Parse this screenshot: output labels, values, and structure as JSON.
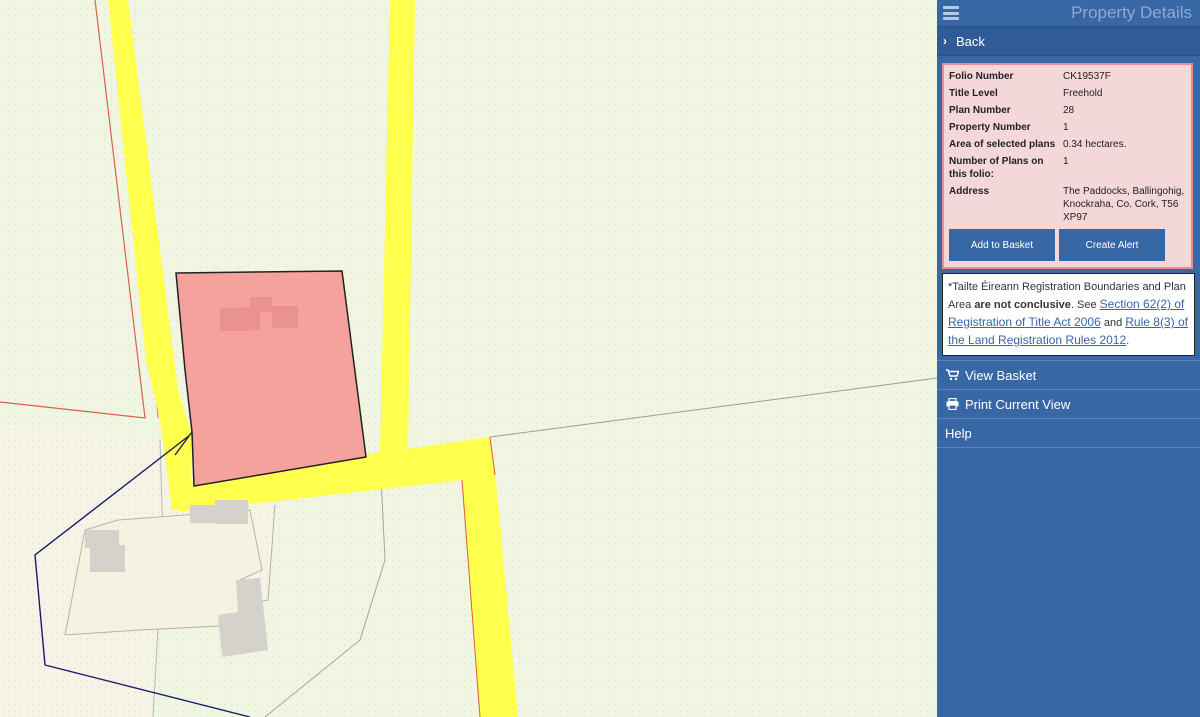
{
  "panel": {
    "title": "Property Details",
    "back_label": "Back",
    "details": [
      {
        "label": "Folio Number",
        "value": "CK19537F"
      },
      {
        "label": "Title Level",
        "value": "Freehold"
      },
      {
        "label": "Plan Number",
        "value": "28"
      },
      {
        "label": "Property Number",
        "value": "1"
      },
      {
        "label": "Area of selected plans",
        "value": "0.34 hectares."
      },
      {
        "label": "Number of Plans on this folio:",
        "value": "1"
      },
      {
        "label": "Address",
        "value": "The Paddocks, Ballingohig, Knockraha, Co. Cork, T56 XP97"
      }
    ],
    "add_basket_label": "Add to Basket",
    "create_alert_label": "Create Alert",
    "notice": {
      "text_1": "*Tailte Éireann Registration Boundaries and Plan Area",
      "bold": "are not conclusive",
      "text_2": ". See",
      "link_1": "Section 62(2) of Registration of Title Act 2006",
      "text_3": "and",
      "link_2": "Rule 8(3) of the Land Registration Rules 2012",
      "text_4": "."
    },
    "nav": [
      {
        "label": "View Basket",
        "icon": "cart-icon"
      },
      {
        "label": "Print Current View",
        "icon": "print-icon"
      },
      {
        "label": "Help",
        "icon": ""
      }
    ]
  },
  "colors": {
    "panel_blue": "#3867a6",
    "parcel_fill": "#f5a29c",
    "road_yellow": "#ffff4d",
    "map_background": "#f1f6e3"
  }
}
